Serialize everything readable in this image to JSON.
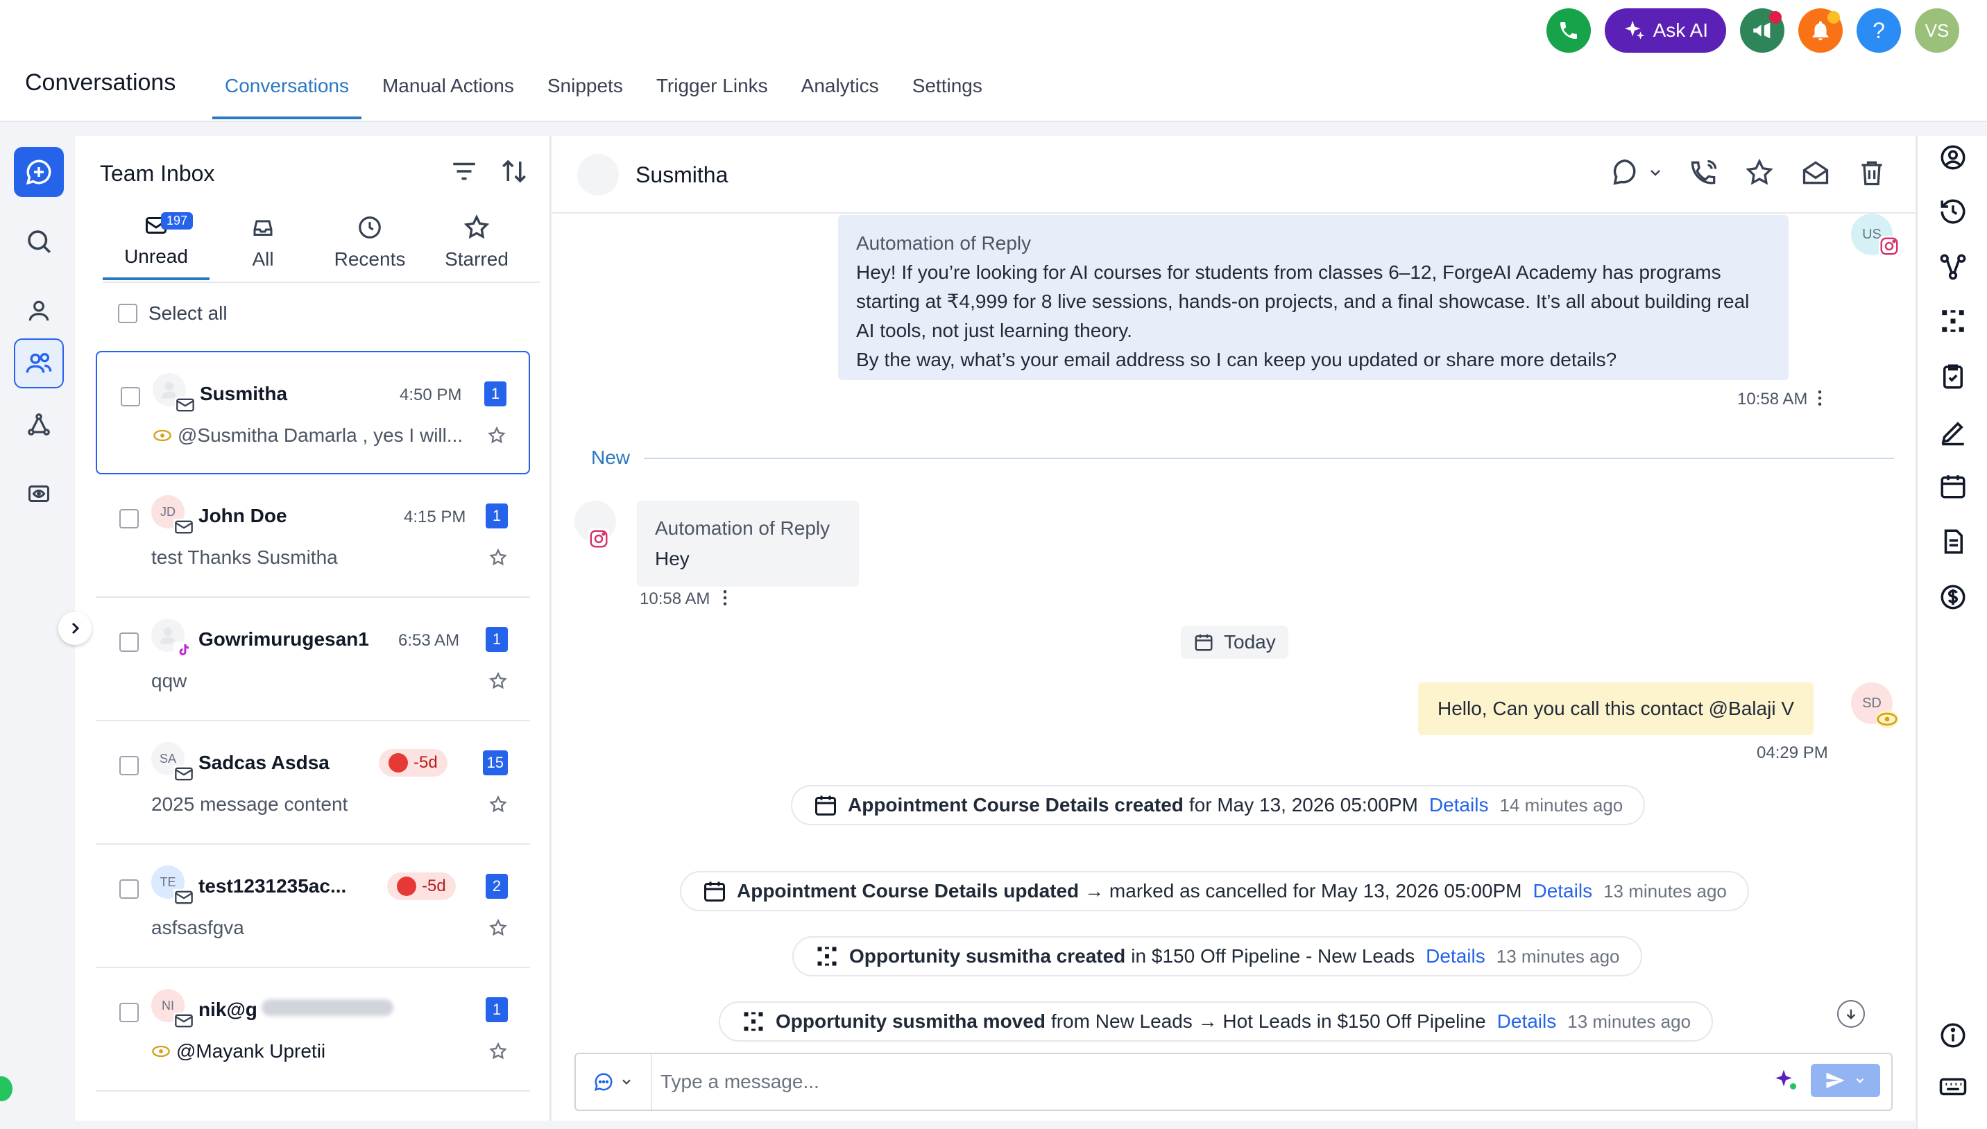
{
  "header": {
    "app_title": "Conversations",
    "tabs": [
      {
        "label": "Conversations",
        "active": true
      },
      {
        "label": "Manual Actions"
      },
      {
        "label": "Snippets"
      },
      {
        "label": "Trigger Links"
      },
      {
        "label": "Analytics"
      },
      {
        "label": "Settings"
      }
    ],
    "ask_ai_label": "Ask AI",
    "help_label": "?",
    "user_initials": "VS",
    "colors": {
      "phone": "#16a34a",
      "ask_ai": "#5b21b6",
      "announce": "#2f855a",
      "bell": "#f97316",
      "help": "#2a8cf4",
      "user": "#9bc07a"
    }
  },
  "inbox": {
    "title": "Team Inbox",
    "filters": [
      {
        "label": "Unread",
        "icon": "inbox-unread-icon",
        "count": "197",
        "active": true
      },
      {
        "label": "All",
        "icon": "inbox-all-icon"
      },
      {
        "label": "Recents",
        "icon": "clock-icon"
      },
      {
        "label": "Starred",
        "icon": "star-icon"
      }
    ],
    "select_all_label": "Select all",
    "conversations": [
      {
        "name": "Susmitha",
        "time": "4:50 PM",
        "unread": "1",
        "preview": "@Susmitha Damarla , yes I will...",
        "avatar": "",
        "channel": "email-icon",
        "selected": true
      },
      {
        "name": "John Doe",
        "time": "4:15 PM",
        "unread": "1",
        "preview": "test Thanks Susmitha",
        "avatar": "JD",
        "channel": "email-icon"
      },
      {
        "name": "Gowrimurugesan1",
        "time": "6:53 AM",
        "unread": "1",
        "preview": "qqw",
        "avatar": "",
        "channel": "tiktok-icon"
      },
      {
        "name": "Sadcas Asdsa",
        "overdue": "-5d",
        "unread": "15",
        "preview": "2025 message content",
        "avatar": "SA",
        "channel": "email-icon"
      },
      {
        "name": "test1231235ac...",
        "overdue": "-5d",
        "unread": "2",
        "preview": "asfsasfgva",
        "avatar": "TE",
        "channel": "email-icon"
      },
      {
        "name": "nik@g",
        "unread": "1",
        "preview": "@Mayank Upretii",
        "avatar": "NI",
        "channel": "email-icon"
      }
    ]
  },
  "chat": {
    "contact_name": "Susmitha",
    "messages": {
      "auto1_label": "Automation of Reply",
      "auto1_body": "Hey! If you’re looking for AI courses for students from classes 6–12, ForgeAI Academy has programs starting at ₹4,999 for 8 live sessions, hands-on projects, and a final showcase. It’s all about building real AI tools, not just learning theory.",
      "auto1_body2": "By the way, what’s your email address so I can keep you updated or share more details?",
      "auto1_time": "10:58 AM",
      "auto1_avatar": "US",
      "divider_new": "New",
      "in1_label": "Automation of Reply",
      "in1_body": "Hey",
      "in1_time": "10:58 AM",
      "today_label": "Today",
      "out1_body": "Hello, Can you call this contact @Balaji V",
      "out1_time": "04:29 PM",
      "out1_avatar": "SD"
    },
    "activities": [
      {
        "bold": "Appointment Course Details created",
        "rest": "for May 13, 2026 05:00PM",
        "link": "Details",
        "ago": "14 minutes ago",
        "icon": "calendar-icon"
      },
      {
        "bold": "Appointment Course Details updated",
        "rest": "→ marked as cancelled for May 13, 2026 05:00PM",
        "link": "Details",
        "ago": "13 minutes ago",
        "icon": "calendar-icon"
      },
      {
        "bold": "Opportunity susmitha created",
        "rest": "in $150 Off Pipeline - New Leads",
        "link": "Details",
        "ago": "13 minutes ago",
        "icon": "pipeline-icon"
      },
      {
        "bold": "Opportunity susmitha moved",
        "rest": "from New Leads → Hot Leads in $150 Off Pipeline",
        "link": "Details",
        "ago": "13 minutes ago",
        "icon": "pipeline-icon"
      }
    ],
    "composer": {
      "placeholder": "Type a message..."
    }
  }
}
